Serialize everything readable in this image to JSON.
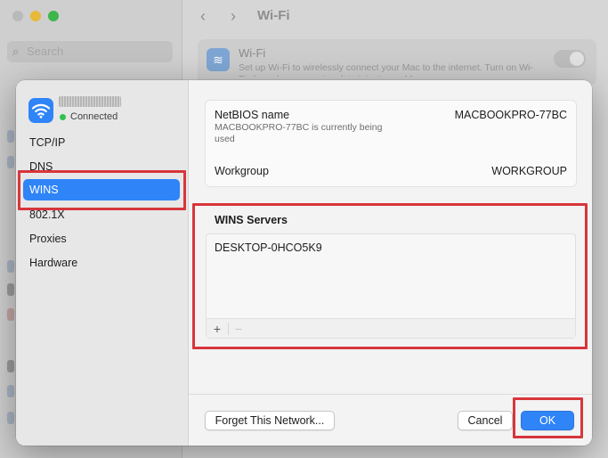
{
  "background": {
    "search_placeholder": "Search",
    "window_title": "Wi-Fi",
    "wifi_card_title": "Wi-Fi",
    "wifi_card_desc": "Set up Wi-Fi to wirelessly connect your Mac to the internet. Turn on Wi-Fi, then choose a network to join. Learn More..."
  },
  "network": {
    "name": "",
    "status": "Connected"
  },
  "sidebar": {
    "items": [
      {
        "label": "TCP/IP"
      },
      {
        "label": "DNS"
      },
      {
        "label": "WINS"
      },
      {
        "label": "802.1X"
      },
      {
        "label": "Proxies"
      },
      {
        "label": "Hardware"
      }
    ],
    "selected": "WINS"
  },
  "netbios": {
    "label": "NetBIOS name",
    "value": "MACBOOKPRO-77BC",
    "note": "MACBOOKPRO-77BC is currently being used"
  },
  "workgroup": {
    "label": "Workgroup",
    "value": "WORKGROUP"
  },
  "wins": {
    "title": "WINS Servers",
    "servers": [
      "DESKTOP-0HCO5K9"
    ],
    "add_label": "+",
    "remove_label": "−"
  },
  "footer": {
    "forget_label": "Forget This Network...",
    "cancel_label": "Cancel",
    "ok_label": "OK"
  },
  "colors": {
    "accent": "#2f84f7",
    "annotation": "#d7363b",
    "connected": "#32c14e"
  }
}
